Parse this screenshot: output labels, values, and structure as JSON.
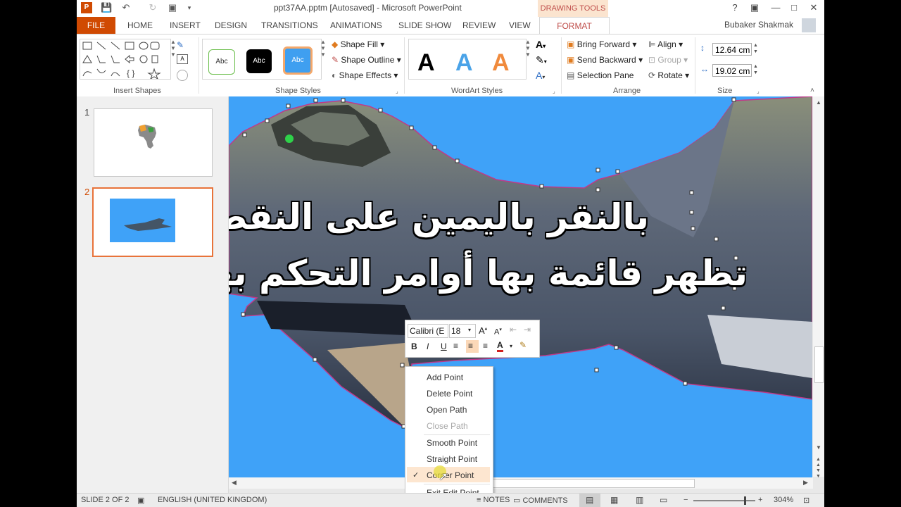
{
  "window": {
    "title": "ppt37AA.pptm [Autosaved] - Microsoft PowerPoint",
    "contextual_tab_group": "DRAWING TOOLS",
    "help_label": "?",
    "user": "Bubaker Shakmak"
  },
  "tabs": [
    "FILE",
    "HOME",
    "INSERT",
    "DESIGN",
    "TRANSITIONS",
    "ANIMATIONS",
    "SLIDE SHOW",
    "REVIEW",
    "VIEW",
    "FORMAT"
  ],
  "active_tab": "FORMAT",
  "ribbon": {
    "insert_shapes": {
      "label": "Insert Shapes"
    },
    "shape_styles": {
      "label": "Shape Styles",
      "style_samples": [
        "Abc",
        "Abc",
        "Abc"
      ],
      "shape_fill": "Shape Fill",
      "shape_outline": "Shape Outline",
      "shape_effects": "Shape Effects"
    },
    "wordart_styles": {
      "label": "WordArt Styles",
      "samples": [
        "A",
        "A",
        "A"
      ]
    },
    "arrange": {
      "label": "Arrange",
      "bring_forward": "Bring Forward",
      "send_backward": "Send Backward",
      "selection_pane": "Selection Pane",
      "align": "Align",
      "group": "Group",
      "rotate": "Rotate"
    },
    "size": {
      "label": "Size",
      "height": "12.64 cm",
      "width": "19.02 cm"
    }
  },
  "slides_pane": {
    "numbers": [
      "1",
      "2"
    ],
    "selected": "2"
  },
  "slide": {
    "caption_line1": "بالنقر باليمين على النقطة",
    "caption_line2": "تظهر قائمة بها أوامر التحكم بها"
  },
  "mini_toolbar": {
    "font_name": "Calibri (E",
    "font_size": "18",
    "bold": "B",
    "italic": "I",
    "underline": "U"
  },
  "context_menu": {
    "items": [
      "Add Point",
      "Delete Point",
      "Open Path",
      "Close Path",
      "Smooth Point",
      "Straight Point",
      "Corner Point",
      "Exit Edit Point"
    ],
    "disabled": [
      "Close Path"
    ],
    "checked": "Corner Point"
  },
  "status_bar": {
    "slide_info": "SLIDE 2 OF 2",
    "language": "ENGLISH (UNITED KINGDOM)",
    "notes": "NOTES",
    "comments": "COMMENTS",
    "zoom": "304%"
  },
  "colors": {
    "accent": "#d04a02",
    "slide_bg": "#3fa2f8",
    "contextual": "#c0504d"
  }
}
